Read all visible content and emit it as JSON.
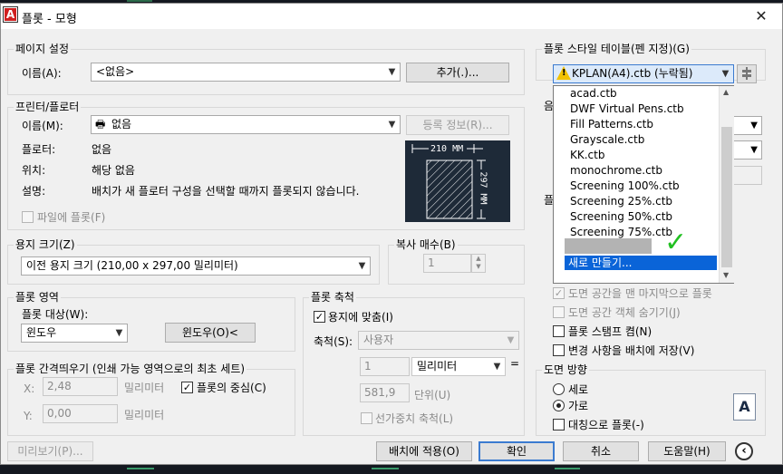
{
  "title_bar": {
    "app_icon_letter": "A",
    "title": "플롯 - 모형",
    "close_glyph": "✕"
  },
  "page_setup": {
    "group_label": "페이지 설정",
    "name_label": "이름(A):",
    "name_value": "<없음>",
    "add_button": "추가(.)..."
  },
  "printer": {
    "group_label": "프린터/플로터",
    "name_label": "이름(M):",
    "name_value": "없음",
    "properties_button": "등록 정보(R)...",
    "plotter_label": "플로터:",
    "plotter_value": "없음",
    "location_label": "위치:",
    "location_value": "해당 없음",
    "description_label": "설명:",
    "description_value": "배치가 새 플로터 구성을 선택할 때까지 플롯되지 않습니다.",
    "plot_to_file_label": "파일에 플롯(F)",
    "preview_width": "210 MM",
    "preview_height": "297 MM"
  },
  "paper_size": {
    "group_label": "용지 크기(Z)",
    "value": "이전 용지 크기 (210,00 x 297,00 밀리미터)"
  },
  "copies": {
    "group_label": "복사 매수(B)",
    "value": "1"
  },
  "plot_area": {
    "group_label": "플롯 영역",
    "what_label": "플롯 대상(W):",
    "what_value": "윈도우",
    "window_button": "윈도우(O)<"
  },
  "plot_offset": {
    "group_label": "플롯 간격띄우기 (인쇄 가능 영역으로의 최초 세트)",
    "x_label": "X:",
    "x_value": "2,48",
    "x_unit": "밀리미터",
    "y_label": "Y:",
    "y_value": "0,00",
    "y_unit": "밀리미터",
    "center_label": "플롯의 중심(C)"
  },
  "plot_scale": {
    "group_label": "플롯 축척",
    "fit_label": "용지에 맞춤(I)",
    "scale_label": "축척(S):",
    "scale_value": "사용자",
    "value1": "1",
    "unit": "밀리미터",
    "equals": "=",
    "value2": "581,9",
    "unit2": "단위(U)",
    "lineweights_label": "선가중치 축척(L)"
  },
  "plot_style_table": {
    "group_label": "플롯 스타일 테이블(펜 지정)(G)",
    "value": "KPLAN(A4).ctb (누락됨)",
    "warning_icon_glyph": "!",
    "options": [
      "acad.ctb",
      "DWF Virtual Pens.ctb",
      "Fill Patterns.ctb",
      "Grayscale.ctb",
      "KK.ctb",
      "monochrome.ctb",
      "Screening 100%.ctb",
      "Screening 25%.ctb",
      "Screening 50%.ctb",
      "Screening 75%.ctb"
    ],
    "new_item": "새로 만들기...",
    "check_mark": "✓"
  },
  "plot_options": {
    "paperspace_last": "도면 공간을 맨 마지막으로 플롯",
    "hide_objects": "도면 공간 객체 숨기기(J)",
    "stamp_on": "플롯 스탬프 켬(N)",
    "save_changes": "변경 사항을 배치에 저장(V)"
  },
  "orientation": {
    "group_label": "도면 방향",
    "portrait": "세로",
    "landscape": "가로",
    "upside_down": "대칭으로 플롯(-)",
    "icon_letter": "A"
  },
  "partial_labels": {
    "a": "음",
    "b": "플"
  },
  "footer": {
    "preview_button": "미리보기(P)...",
    "apply_button": "배치에 적용(O)",
    "ok_button": "확인",
    "cancel_button": "취소",
    "help_button": "도움말(H)",
    "expand_glyph": "‹"
  },
  "colors": {
    "accent_blue": "#0a64d8",
    "check_green": "#22c022",
    "warning_yellow": "#f2c200"
  }
}
